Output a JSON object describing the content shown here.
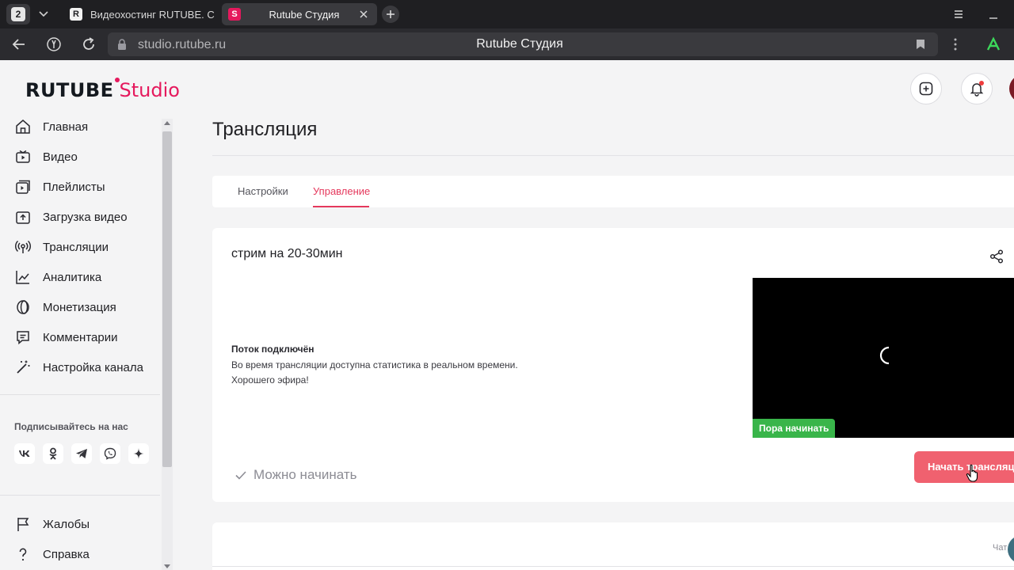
{
  "browser": {
    "tab_count": "2",
    "tabs": [
      {
        "favicon": "R",
        "title": "Видеохостинг RUTUBE. С"
      },
      {
        "favicon": "S",
        "title": "Rutube Студия"
      }
    ],
    "url": "studio.rutube.ru",
    "page_title": "Rutube Студия"
  },
  "logo": {
    "brand": "RUTUBE",
    "product": "Studio"
  },
  "sidebar": {
    "items": [
      {
        "label": "Главная",
        "icon": "home-icon"
      },
      {
        "label": "Видео",
        "icon": "video-icon"
      },
      {
        "label": "Плейлисты",
        "icon": "playlist-icon"
      },
      {
        "label": "Загрузка видео",
        "icon": "upload-icon"
      },
      {
        "label": "Трансляции",
        "icon": "broadcast-icon"
      },
      {
        "label": "Аналитика",
        "icon": "analytics-icon"
      },
      {
        "label": "Монетизация",
        "icon": "coin-icon"
      },
      {
        "label": "Комментарии",
        "icon": "comments-icon"
      },
      {
        "label": "Настройка канала",
        "icon": "magic-wand-icon"
      }
    ],
    "follow_label": "Подписывайтесь на нас",
    "socials": [
      {
        "label": "vk",
        "icon": "vk-icon"
      },
      {
        "label": "ok",
        "icon": "ok-icon"
      },
      {
        "label": "telegram",
        "icon": "telegram-icon"
      },
      {
        "label": "viber",
        "icon": "viber-icon"
      },
      {
        "label": "dzen",
        "icon": "dzen-icon"
      }
    ],
    "bottom_items": [
      {
        "label": "Жалобы",
        "icon": "flag-icon"
      },
      {
        "label": "Справка",
        "icon": "help-icon"
      }
    ]
  },
  "main": {
    "title": "Трансляция",
    "tabs": [
      {
        "label": "Настройки",
        "active": false
      },
      {
        "label": "Управление",
        "active": true
      }
    ],
    "stream": {
      "name": "стрим на 20-30мин",
      "status_title": "Поток подключён",
      "status_lines": [
        "Во время трансляции доступна статистика в реальном времени.",
        "Хорошего эфира!"
      ],
      "preview_badge": "Пора начинать",
      "ready_text": "Можно начинать",
      "start_button": "Начать трансляцию"
    },
    "chat_label": "Чат"
  },
  "colors": {
    "accent": "#e5195d",
    "tab_active": "#e5395d",
    "start_button": "#f0616f",
    "badge_green": "#39b54a"
  }
}
